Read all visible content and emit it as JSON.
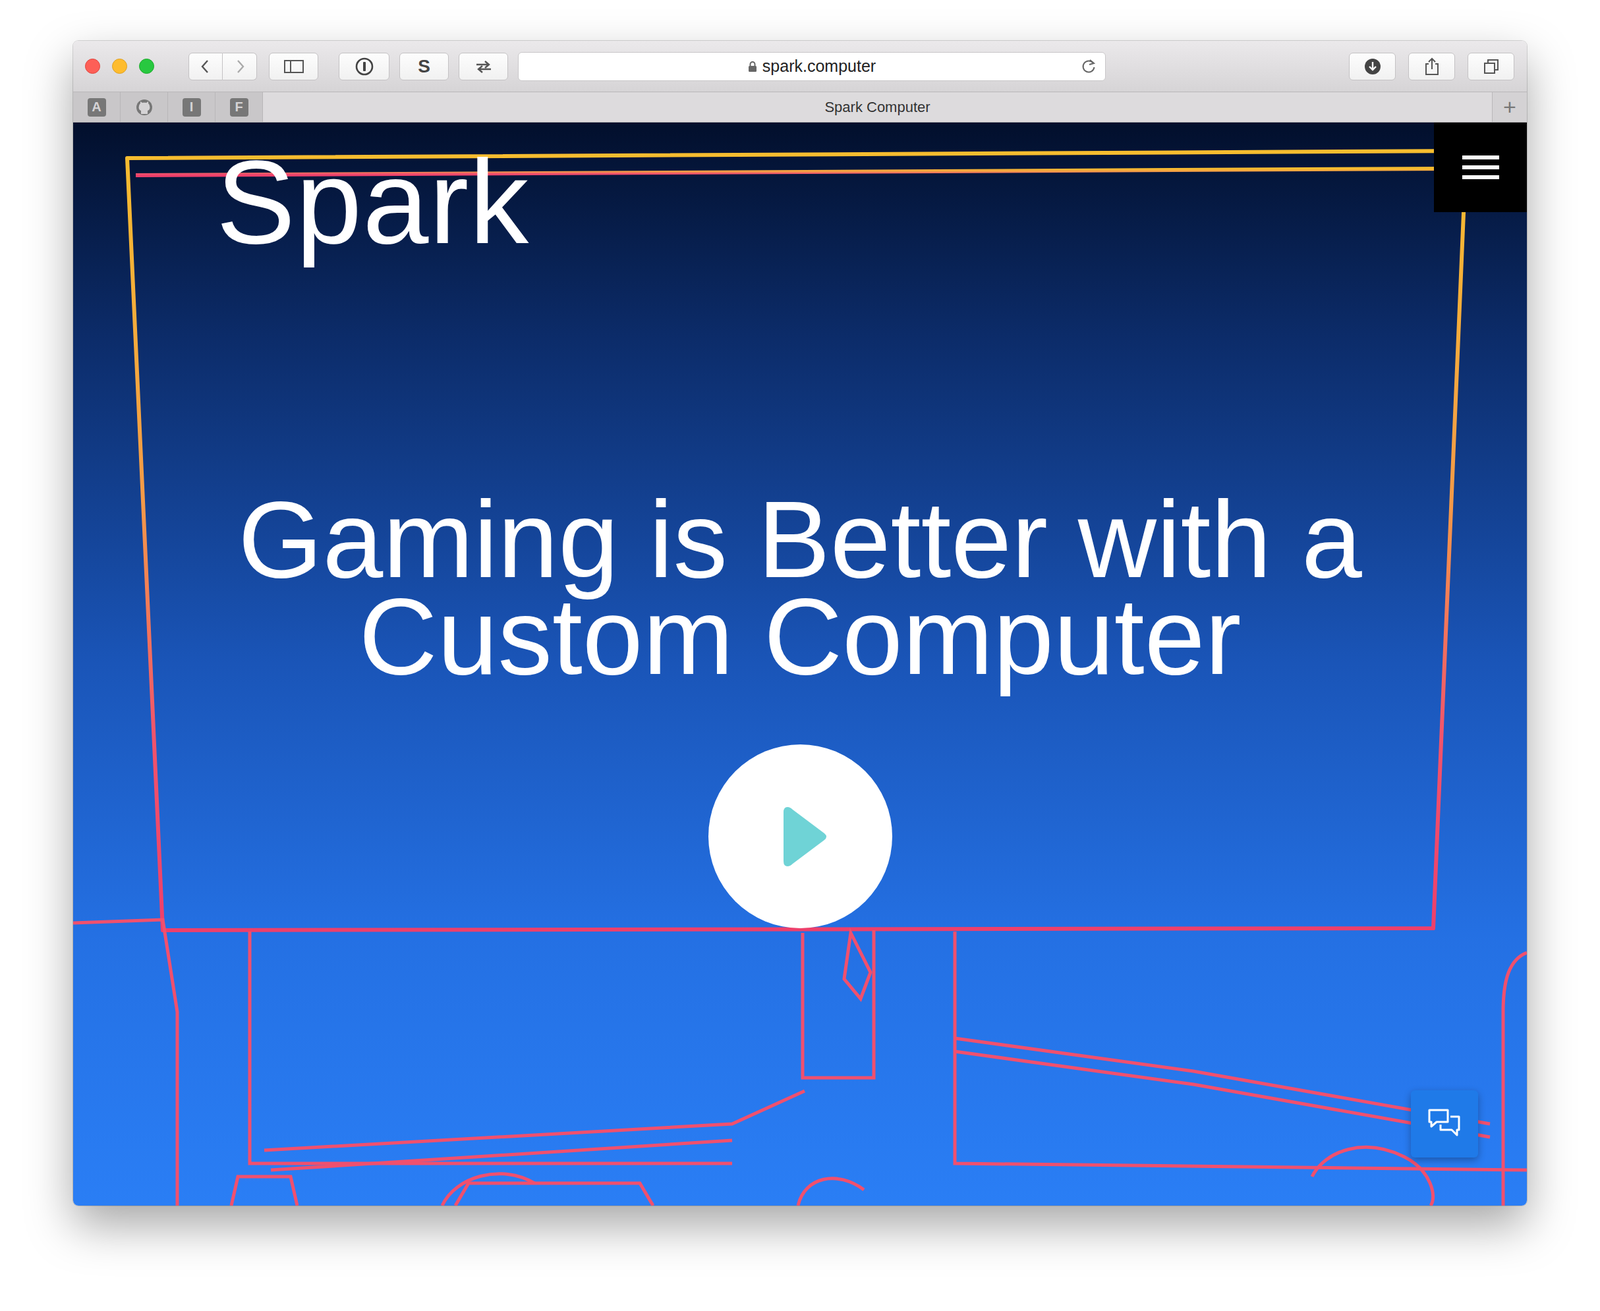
{
  "window": {
    "url": "spark.computer",
    "tab_title": "Spark Computer"
  },
  "toolbar": {
    "extension_label": "S"
  },
  "favorites": [
    {
      "kind": "letter",
      "label": "A"
    },
    {
      "kind": "github"
    },
    {
      "kind": "letter",
      "label": "I"
    },
    {
      "kind": "letter",
      "label": "F"
    }
  ],
  "new_tab": "+",
  "page": {
    "logo": "Spark",
    "headline": "Gaming is Better with a Custom Computer"
  }
}
